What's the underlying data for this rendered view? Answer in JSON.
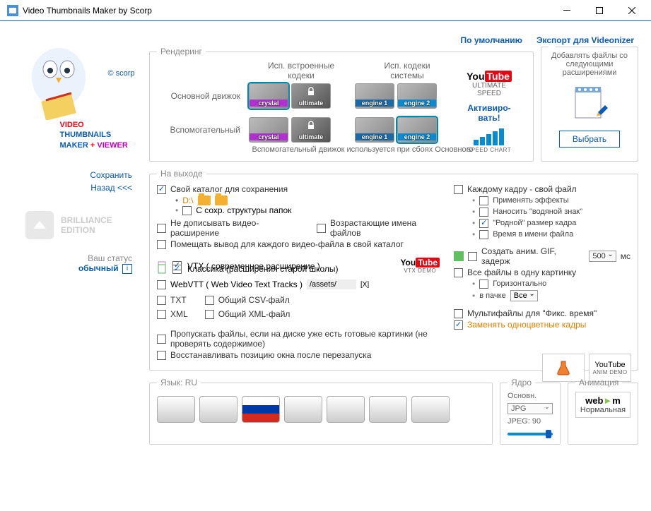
{
  "window": {
    "title": "Video Thumbnails Maker by Scorp"
  },
  "sidebar": {
    "brand_line1a": "VIDEO",
    "brand_line2": "THUMBNAILS",
    "brand_line3a": "MAKER ",
    "brand_line3b": "+ ",
    "brand_line3c": "VIEWER",
    "scorp": "© scorp",
    "save": "Сохранить",
    "back": "Назад <<<",
    "brilliance1": "BRILLIANCE",
    "brilliance2": "EDITION",
    "status_lbl": "Ваш статус",
    "status_val": "обычный"
  },
  "tabs": {
    "default": "По умолчанию",
    "export": "Экспорт для Videonizer"
  },
  "render": {
    "legend": "Рендеринг",
    "head_builtin": "Исп. встроенные кодеки",
    "head_system": "Исп. кодеки системы",
    "main_lbl": "Основной движок",
    "helper_lbl": "Вспомогательный",
    "codec_crystal": "crystal",
    "codec_ultimate": "ultimate",
    "codec_engine1": "engine 1",
    "codec_engine2": "engine 2",
    "helper_note": "Вспомогательный движок используется при сбоях Основного",
    "yt_ultimate": "ULTIMATE SPEED",
    "activate": "Активиро-\nвать!",
    "speed_chart": "SPEED CHART"
  },
  "export": {
    "legend": "",
    "text": "Добавлять файлы со следующими расширениями",
    "btn": "Выбрать"
  },
  "output": {
    "legend": "На выходе",
    "own_folder": "Свой каталог для сохранения",
    "path": "D:\\",
    "keep_struct": "С сохр. структуры папок",
    "no_append_ext": "Не дописывать видео-расширение",
    "growing_names": "Возрастающие имена файлов",
    "put_per_video": "Помещать вывод для каждого видео-файла в свой каталог",
    "vtx": "VTX ( современное расширение )",
    "classic": "Классика (расширения старой школы)",
    "vtx_demo": "VTX DEMO",
    "webvtt": "WebVTT ( Web Video Text Tracks )",
    "webvtt_path": "/assets/",
    "txt": "TXT",
    "csv": "Общий CSV-файл",
    "xml": "XML",
    "xmlall": "Общий XML-файл",
    "skip_existing": "Пропускать файлы, если на диске уже есть готовые картинки (не проверять содержимое)",
    "restore_pos": "Восстанавливать позицию окна после перезапуска",
    "per_frame": "Каждому кадру - свой файл",
    "apply_fx": "Применять эффекты",
    "watermark": "Наносить \"водяной знак\"",
    "native_size": "\"Родной\" размер кадра",
    "time_in_name": "Время в имени файла",
    "make_gif": "Создать аним. GIF, задерж",
    "gif_delay": "500",
    "ms": "мс",
    "all_one_pic": "Все файлы в одну картинку",
    "horiz": "Горизонтально",
    "in_pack": "в пачке",
    "pack_val": "Все",
    "multifiles": "Мультифайлы для \"Фикс. время\"",
    "replace_mono": "Заменять одноцветные кадры"
  },
  "lang": {
    "legend": "Язык: RU"
  },
  "core": {
    "legend": "Ядро",
    "main": "Основн.",
    "fmt": "JPG",
    "quality": "JPEG: 90"
  },
  "anim": {
    "legend": "Анимация",
    "webm": "web►m",
    "normal": "Нормальная",
    "demo": "ANIM DEMO"
  }
}
